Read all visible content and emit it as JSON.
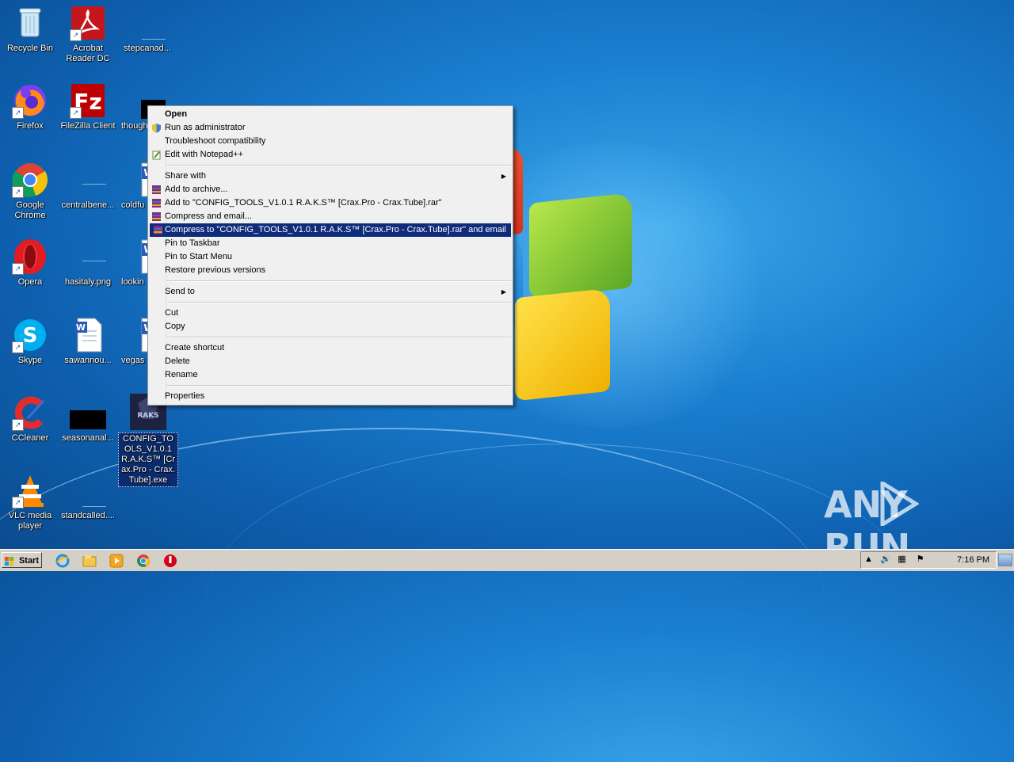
{
  "desktop": {
    "icons": {
      "recycle_bin": "Recycle Bin",
      "acrobat": "Acrobat Reader DC",
      "stepcanad": "stepcanad...",
      "firefox": "Firefox",
      "filezilla": "FileZilla Client",
      "though": "though",
      "chrome": "Google Chrome",
      "centralbene": "centralbene...",
      "coldfu": "coldfu",
      "opera": "Opera",
      "hasitaly": "hasitaly.png",
      "lookin": "lookin",
      "skype": "Skype",
      "sawannou": "sawannou...",
      "vegas": "vegas",
      "ccleaner": "CCleaner",
      "seasonanal": "seasonanal...",
      "config_tools": "CONFIG_TOOLS_V1.0.1 R.A.K.S™ [Crax.Pro - Crax.Tube].exe",
      "vlc": "VLC media player",
      "standcalled": "standcalled...."
    }
  },
  "context_menu": {
    "open": "Open",
    "run_as_admin": "Run as administrator",
    "troubleshoot": "Troubleshoot compatibility",
    "edit_notepad": "Edit with Notepad++",
    "share_with": "Share with",
    "add_to_archive": "Add to archive...",
    "add_to_rar": "Add to \"CONFIG_TOOLS_V1.0.1 R.A.K.S™ [Crax.Pro - Crax.Tube].rar\"",
    "compress_email": "Compress and email...",
    "compress_to_rar_email": "Compress to \"CONFIG_TOOLS_V1.0.1 R.A.K.S™ [Crax.Pro - Crax.Tube].rar\" and email",
    "pin_taskbar": "Pin to Taskbar",
    "pin_start": "Pin to Start Menu",
    "restore_versions": "Restore previous versions",
    "send_to": "Send to",
    "cut": "Cut",
    "copy": "Copy",
    "create_shortcut": "Create shortcut",
    "delete": "Delete",
    "rename": "Rename",
    "properties": "Properties",
    "highlight_color": "#0f2c7a"
  },
  "taskbar": {
    "start_label": "Start",
    "clock": "7:16 PM",
    "pinned": [
      "ie-icon",
      "explorer-icon",
      "media-player-icon",
      "chrome-icon",
      "antivirus-icon"
    ]
  },
  "watermark": {
    "left": "ANY",
    "right": "RUN"
  }
}
